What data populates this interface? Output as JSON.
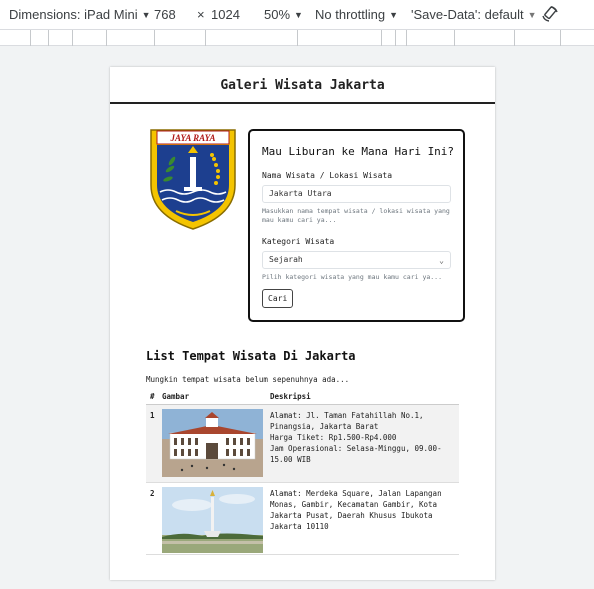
{
  "devtools": {
    "dimensions_label": "Dimensions: iPad Mini",
    "width": "768",
    "times": "×",
    "height": "1024",
    "zoom": "50%",
    "throttling": "No throttling",
    "save_data": "'Save-Data': default"
  },
  "page": {
    "title": "Galeri Wisata Jakarta",
    "logo_text": "JAYA RAYA"
  },
  "form": {
    "heading": "Mau Liburan ke Mana Hari Ini?",
    "name_label": "Nama Wisata / Lokasi Wisata",
    "name_value": "Jakarta Utara",
    "name_hint": "Masukkan nama tempat wisata / lokasi wisata yang mau kamu cari ya...",
    "category_label": "Kategori Wisata",
    "category_value": "Sejarah",
    "category_hint": "Pilih kategori wisata yang mau kamu cari ya...",
    "submit_label": "Cari"
  },
  "list": {
    "title": "List Tempat Wisata Di Jakarta",
    "note": "Mungkin tempat wisata belum sepenuhnya ada...",
    "headers": [
      "#",
      "Gambar",
      "Deskripsi"
    ],
    "rows": [
      {
        "num": "1",
        "desc": "Alamat: Jl. Taman Fatahillah No.1, Pinangsia, Jakarta Barat\nHarga Tiket: Rp1.500-Rp4.000\nJam Operasional: Selasa-Minggu, 09.00-15.00 WIB"
      },
      {
        "num": "2",
        "desc": "Alamat: Merdeka Square, Jalan Lapangan Monas, Gambir, Kecamatan Gambir, Kota Jakarta Pusat, Daerah Khusus Ibukota Jakarta 10110"
      }
    ]
  }
}
